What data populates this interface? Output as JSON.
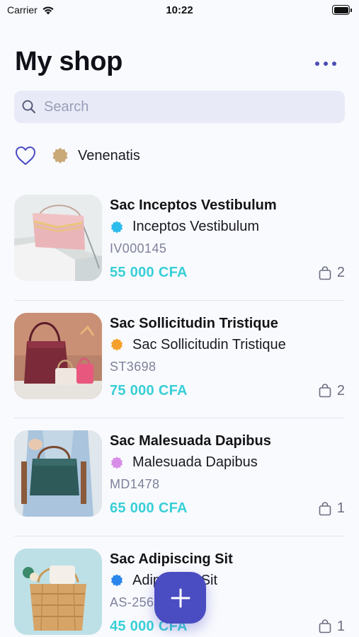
{
  "status_bar": {
    "carrier": "Carrier",
    "time": "10:22"
  },
  "header": {
    "title": "My shop",
    "more_icon": "ellipsis-icon"
  },
  "search": {
    "placeholder": "Search",
    "value": ""
  },
  "filters": {
    "favorites_icon": "heart-outline-icon",
    "chip": {
      "label": "Venenatis",
      "color": "#c9a978"
    }
  },
  "products": [
    {
      "name": "Sac Inceptos Vestibulum",
      "brand": "Inceptos Vestibulum",
      "brand_color": "#2bbcec",
      "sku": "IV000145",
      "price": "55 000 CFA",
      "stock": "2"
    },
    {
      "name": "Sac Sollicitudin Tristique",
      "brand": "Sac Sollicitudin Tristique",
      "brand_color": "#f5a02a",
      "sku": "ST3698",
      "price": "75 000 CFA",
      "stock": "2"
    },
    {
      "name": "Sac Malesuada Dapibus",
      "brand": "Malesuada Dapibus",
      "brand_color": "#d88ee8",
      "sku": "MD1478",
      "price": "65 000 CFA",
      "stock": "1"
    },
    {
      "name": "Sac Adipiscing Sit",
      "brand": "Adipiscing Sit",
      "brand_color": "#2b86ec",
      "sku": "AS-256",
      "price": "45 000 CFA",
      "stock": "1"
    }
  ],
  "fab": {
    "icon": "plus-icon",
    "color": "#4a4cc2"
  },
  "colors": {
    "accent": "#4a4cc2",
    "price": "#38cfd6",
    "background": "#f9fafe"
  }
}
